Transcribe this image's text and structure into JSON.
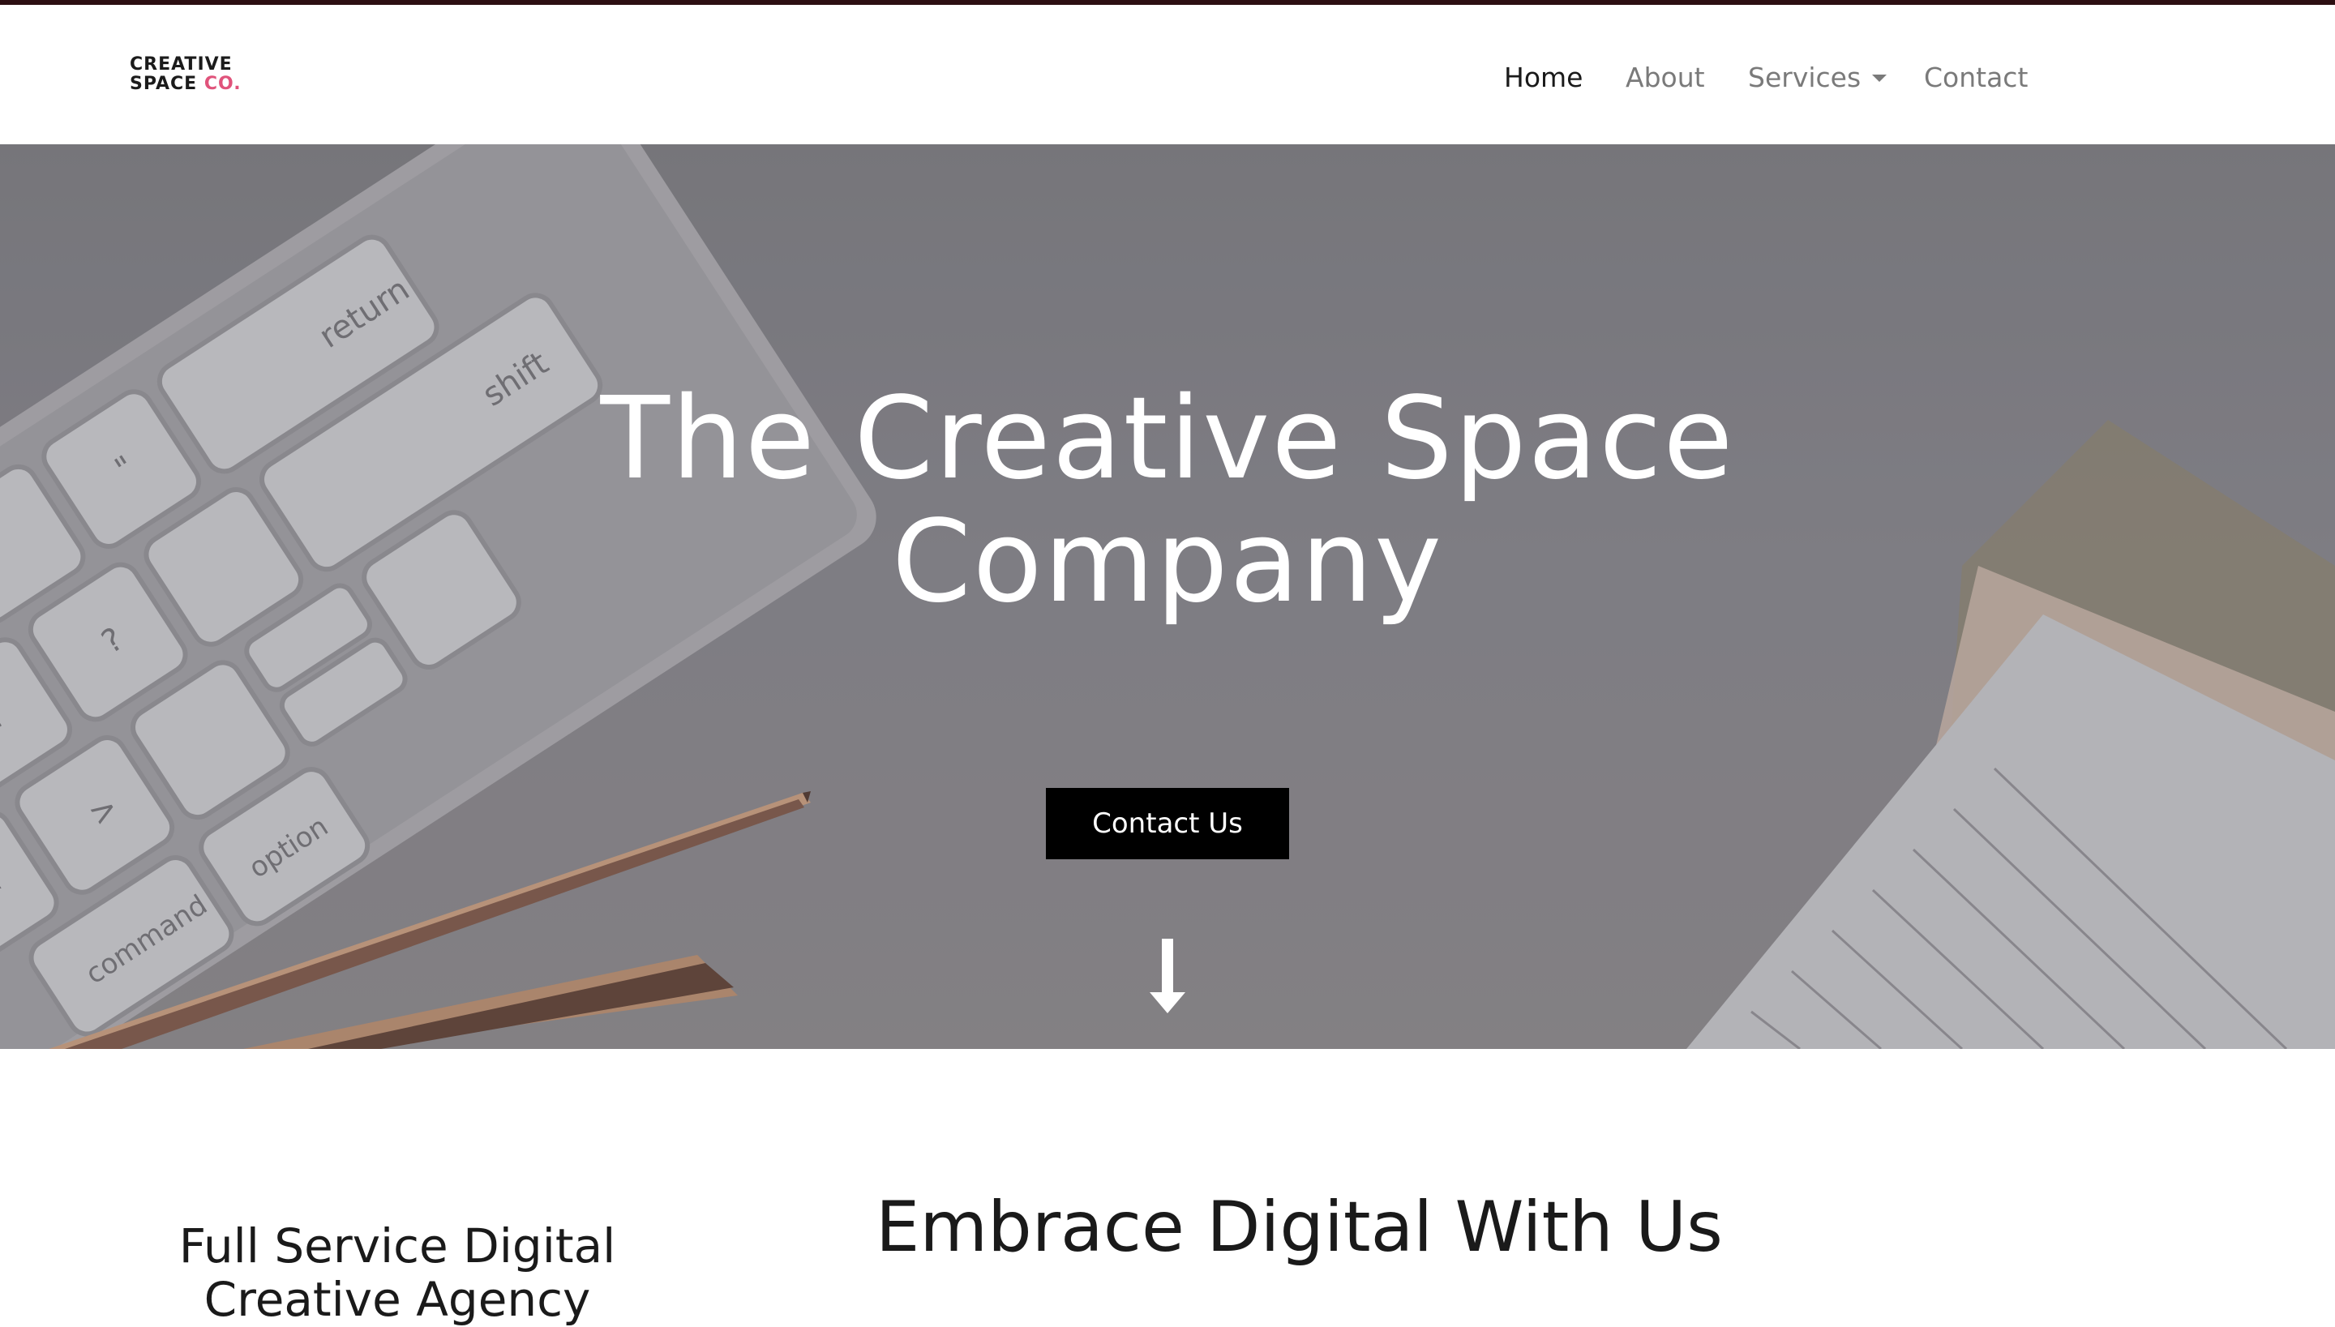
{
  "brand": {
    "logo_line1": "CREATIVE",
    "logo_line2_prefix": "SPACE",
    "logo_line2_accent": "CO.",
    "accent_color": "#e0537b",
    "top_border_color": "#2d0f12"
  },
  "nav": {
    "home": "Home",
    "about": "About",
    "services": "Services",
    "contact": "Contact",
    "active": "Home"
  },
  "hero": {
    "title": "The Creative Space Company",
    "cta_label": "Contact Us",
    "scroll_icon": "arrow-down-icon",
    "background": "desk-with-keyboard-pen-notebook-photo"
  },
  "content": {
    "side_heading": "Full Service Digital Creative Agency",
    "main_heading": "Embrace Digital With Us"
  }
}
